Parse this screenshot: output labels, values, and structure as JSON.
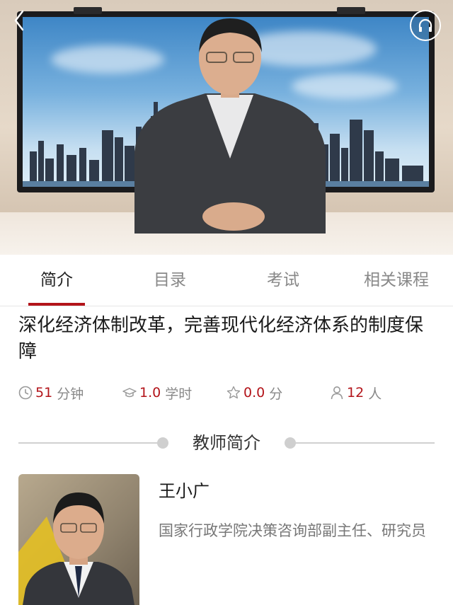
{
  "tabs": [
    {
      "label": "简介",
      "active": true
    },
    {
      "label": "目录",
      "active": false
    },
    {
      "label": "考试",
      "active": false
    },
    {
      "label": "相关课程",
      "active": false
    }
  ],
  "course": {
    "title": "深化经济体制改革，完善现代化经济体系的制度保障"
  },
  "stats": {
    "duration": {
      "value": "51",
      "unit": "分钟",
      "icon": "clock-icon"
    },
    "credit": {
      "value": "1.0",
      "unit": "学时",
      "icon": "graduation-cap-icon"
    },
    "rating": {
      "value": "0.0",
      "unit": "分",
      "icon": "star-icon"
    },
    "learners": {
      "value": "12",
      "unit": "人",
      "icon": "person-icon"
    }
  },
  "teacher_section": {
    "heading": "教师简介"
  },
  "teacher": {
    "name": "王小广",
    "description": "国家行政学院决策咨询部副主任、研究员"
  },
  "colors": {
    "accent": "#b3141a",
    "muted_text": "#888888",
    "divider": "#d0d0d0"
  },
  "icons": {
    "back": "back-chevron-icon",
    "audio": "headphones-icon"
  }
}
